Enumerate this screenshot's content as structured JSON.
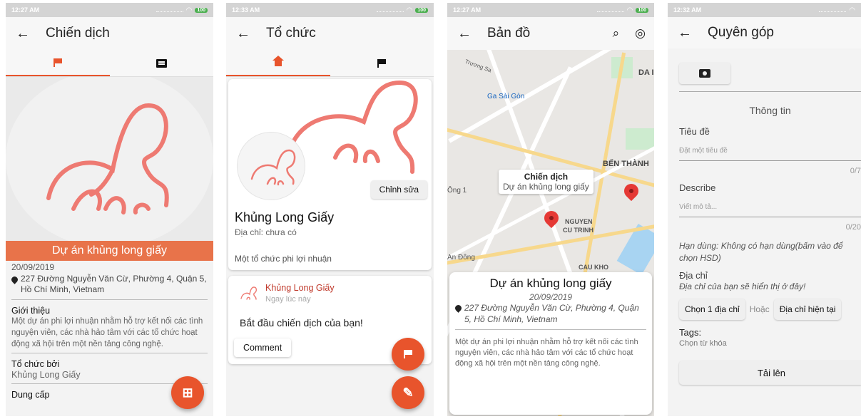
{
  "screen1": {
    "status": {
      "time": "12:27 AM",
      "battery": "100"
    },
    "title": "Chiến dịch",
    "tabs": [
      {
        "icon": "flag-icon",
        "active": true
      },
      {
        "icon": "message-icon",
        "active": false
      }
    ],
    "banner": "Dự án khủng long giấy",
    "date": "20/09/2019",
    "address": "227 Đường Nguyễn Văn Cừ, Phường 4, Quận 5, Hồ Chí Minh, Vietnam",
    "intro_title": "Giới thiệu",
    "intro_text": "Một dự án phi lợi nhuận nhằm hỗ trợ kết nối các tình nguyện viên, các nhà hảo tâm với các tổ chức hoạt động xã hội trên một nền tảng công nghệ.",
    "org_title": "Tổ chức bởi",
    "org_value": "Khủng Long Giấy",
    "cut_text": "Dung cấp"
  },
  "screen2": {
    "status": {
      "time": "12:33 AM",
      "battery": "100"
    },
    "title": "Tổ chức",
    "edit_label": "Chỉnh sửa",
    "org_name": "Khủng Long Giấy",
    "org_address": "Địa chỉ: chưa có",
    "org_desc": "Một tổ chức phi lợi nhuận",
    "post_author": "Khủng Long Giấy",
    "post_time": "Ngay lúc này",
    "post_text": "Bắt đầu chiến dịch của bạn!",
    "comment_label": "Comment"
  },
  "screen3": {
    "status": {
      "time": "12:27 AM",
      "battery": "100"
    },
    "title": "Bản đồ",
    "map_labels": {
      "tuong": "Trương Sa",
      "gasaigon": "Ga Sài Gòn",
      "benthanh": "BẾN THÀNH",
      "ong1": "Ông 1",
      "andong": "An Đông",
      "nguyen": "NGUYEN",
      "cutrinh": "CU TRINH",
      "caukho": "CAU KHO",
      "da": "DA I"
    },
    "popup_title": "Chiến dịch",
    "popup_sub": "Dự án khủng long giấy",
    "card_name": "Dự án khủng long giấy",
    "card_date": "20/09/2019",
    "card_address": "227 Đường Nguyễn Văn Cừ, Phường 4, Quận 5, Hồ Chí Minh, Vietnam",
    "card_desc": "Một dự án phi lợi nhuận nhằm hỗ trợ kết nối các tình nguyện viên, các nhà hảo tâm với các tổ chức hoạt động xã hội trên một nền tảng công nghệ."
  },
  "screen4": {
    "status": {
      "time": "12:32 AM"
    },
    "title": "Quyên góp",
    "section": "Thông tin",
    "title_label": "Tiêu đề",
    "title_placeholder": "Đặt một tiêu đề",
    "title_counter": "0/7",
    "describe_label": "Describe",
    "describe_placeholder": "Viết mô tả...",
    "describe_counter": "0/20",
    "expiry_note": "Hạn dùng: Không có hạn dùng(bấm vào để chọn HSD)",
    "address_label": "Địa chỉ",
    "address_note": "Địa chỉ của bạn sẽ hiển thị ở đây!",
    "choose_address": "Chọn 1 địa chỉ",
    "or_text": "Hoặc",
    "current_address": "Địa chỉ hiện tại",
    "tags_label": "Tags:",
    "tags_value": "Chọn từ khóa",
    "upload_label": "Tải lên"
  },
  "colors": {
    "accent": "#e8542c",
    "banner": "#e8734a",
    "pin": "#e53935"
  }
}
